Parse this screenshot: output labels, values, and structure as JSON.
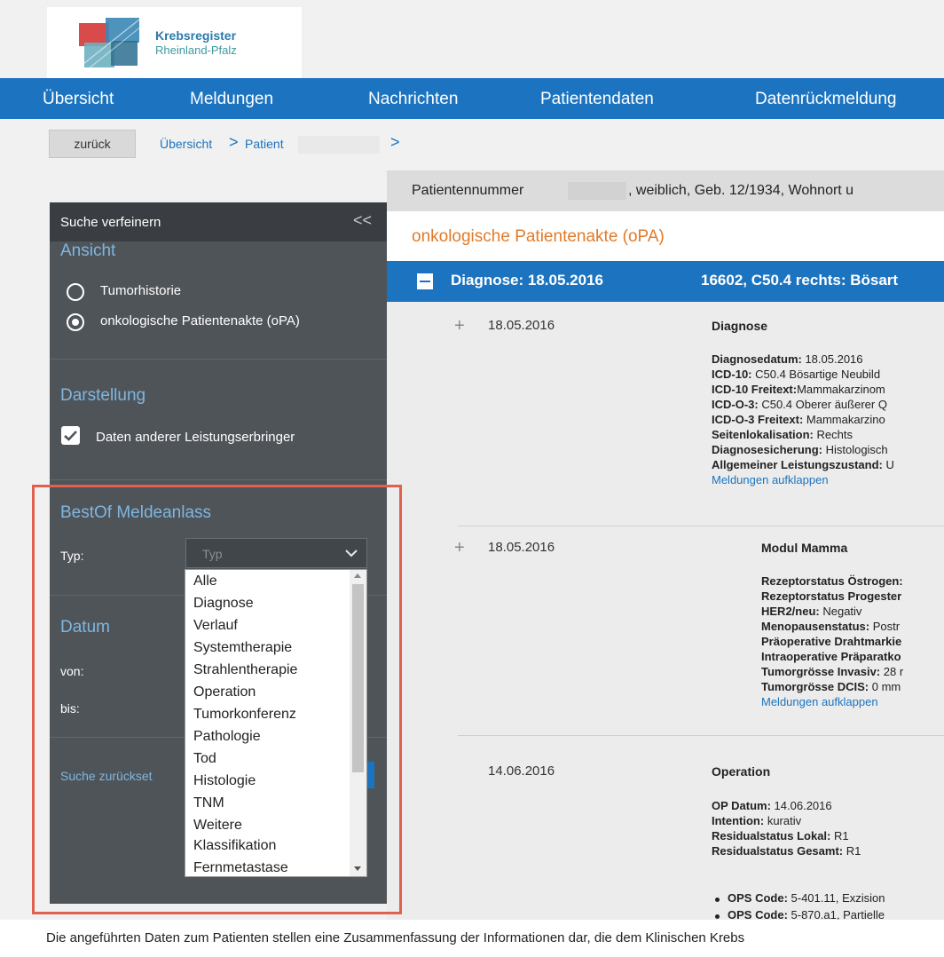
{
  "brand": {
    "line1": "Krebsregister",
    "line2": "Rheinland-Pfalz"
  },
  "nav": {
    "items": [
      "Übersicht",
      "Meldungen",
      "Nachrichten",
      "Patientendaten",
      "Datenrückmeldung"
    ]
  },
  "breadcrumb": {
    "back_label": "zurück",
    "crumb1": "Übersicht",
    "crumb2": "Patient",
    "sep": ">"
  },
  "sidebar": {
    "title": "Suche verfeinern",
    "collapse_glyph": "<<",
    "ansicht": {
      "heading": "Ansicht",
      "option1": "Tumorhistorie",
      "option2": "onkologische Patientenakte (oPA)"
    },
    "darstellung": {
      "heading": "Darstellung",
      "checkbox_label": "Daten anderer Leistungserbringer"
    },
    "bestof": {
      "heading": "BestOf Meldeanlass",
      "typ_label": "Typ:",
      "typ_placeholder": "Typ"
    },
    "datum": {
      "heading": "Datum",
      "von_label": "von:",
      "bis_label": "bis:"
    },
    "reset_label": "Suche zurückset"
  },
  "dropdown": {
    "options": [
      "Alle",
      "Diagnose",
      "Verlauf",
      "Systemtherapie",
      "Strahlentherapie",
      "Operation",
      "Tumorkonferenz",
      "Pathologie",
      "Tod",
      "Histologie",
      "TNM",
      "Weitere",
      "Klassifikation",
      "Fernmetastase"
    ]
  },
  "patient_bar": {
    "label": "Patientennummer",
    "details": ", weiblich, Geb. 12/1934, Wohnort u"
  },
  "opa_title": "onkologische Patientenakte (oPA)",
  "diagnosis_bar": {
    "title": "Diagnose: 18.05.2016",
    "code": "16602, C50.4 rechts: Bösart"
  },
  "entries": [
    {
      "date": "18.05.2016",
      "heading": "Diagnose",
      "lines": [
        {
          "k": "Diagnosedatum:",
          "v": " 18.05.2016"
        },
        {
          "k": "ICD-10:",
          "v": " C50.4 Bösartige Neubild"
        },
        {
          "k": "ICD-10 Freitext:",
          "v": "Mammakarzinom"
        },
        {
          "k": "ICD-O-3:",
          "v": " C50.4 Oberer äußerer Q"
        },
        {
          "k": "ICD-O-3 Freitext:",
          "v": " Mammakarzino"
        },
        {
          "k": "Seitenlokalisation:",
          "v": " Rechts"
        },
        {
          "k": "Diagnosesicherung:",
          "v": " Histologisch"
        },
        {
          "k": "Allgemeiner Leistungszustand:",
          "v": " U"
        }
      ],
      "link": "Meldungen aufklappen"
    },
    {
      "date": "18.05.2016",
      "heading": "Modul Mamma",
      "lines": [
        {
          "k": "Rezeptorstatus Östrogen:",
          "v": ""
        },
        {
          "k": "Rezeptorstatus Progester",
          "v": ""
        },
        {
          "k": "HER2/neu:",
          "v": " Negativ"
        },
        {
          "k": "Menopausenstatus:",
          "v": " Postr"
        },
        {
          "k": "Präoperative Drahtmarkie",
          "v": ""
        },
        {
          "k": "Intraoperative Präparatko",
          "v": ""
        },
        {
          "k": "Tumorgrösse Invasiv:",
          "v": " 28 r"
        },
        {
          "k": "Tumorgrösse DCIS:",
          "v": " 0 mm"
        }
      ],
      "link": "Meldungen aufklappen"
    },
    {
      "date": "14.06.2016",
      "heading": "Operation",
      "lines": [
        {
          "k": "OP Datum:",
          "v": " 14.06.2016"
        },
        {
          "k": "Intention:",
          "v": " kurativ"
        },
        {
          "k": "Residualstatus Lokal:",
          "v": " R1"
        },
        {
          "k": "Residualstatus Gesamt:",
          "v": " R1"
        }
      ],
      "bullets": [
        {
          "k": "OPS Code:",
          "v": " 5-401.11, Exzision"
        },
        {
          "k": "OPS Code:",
          "v": " 5-870.a1, Partielle"
        }
      ]
    }
  ],
  "footer": "Die angeführten Daten zum Patienten stellen eine Zusammenfassung der Informationen dar, die dem Klinischen Krebs",
  "colors": {
    "primary": "#1c74c0",
    "sidebar": "#4f5459",
    "accent_orange": "#e07b2a",
    "highlight": "#e0614d"
  }
}
